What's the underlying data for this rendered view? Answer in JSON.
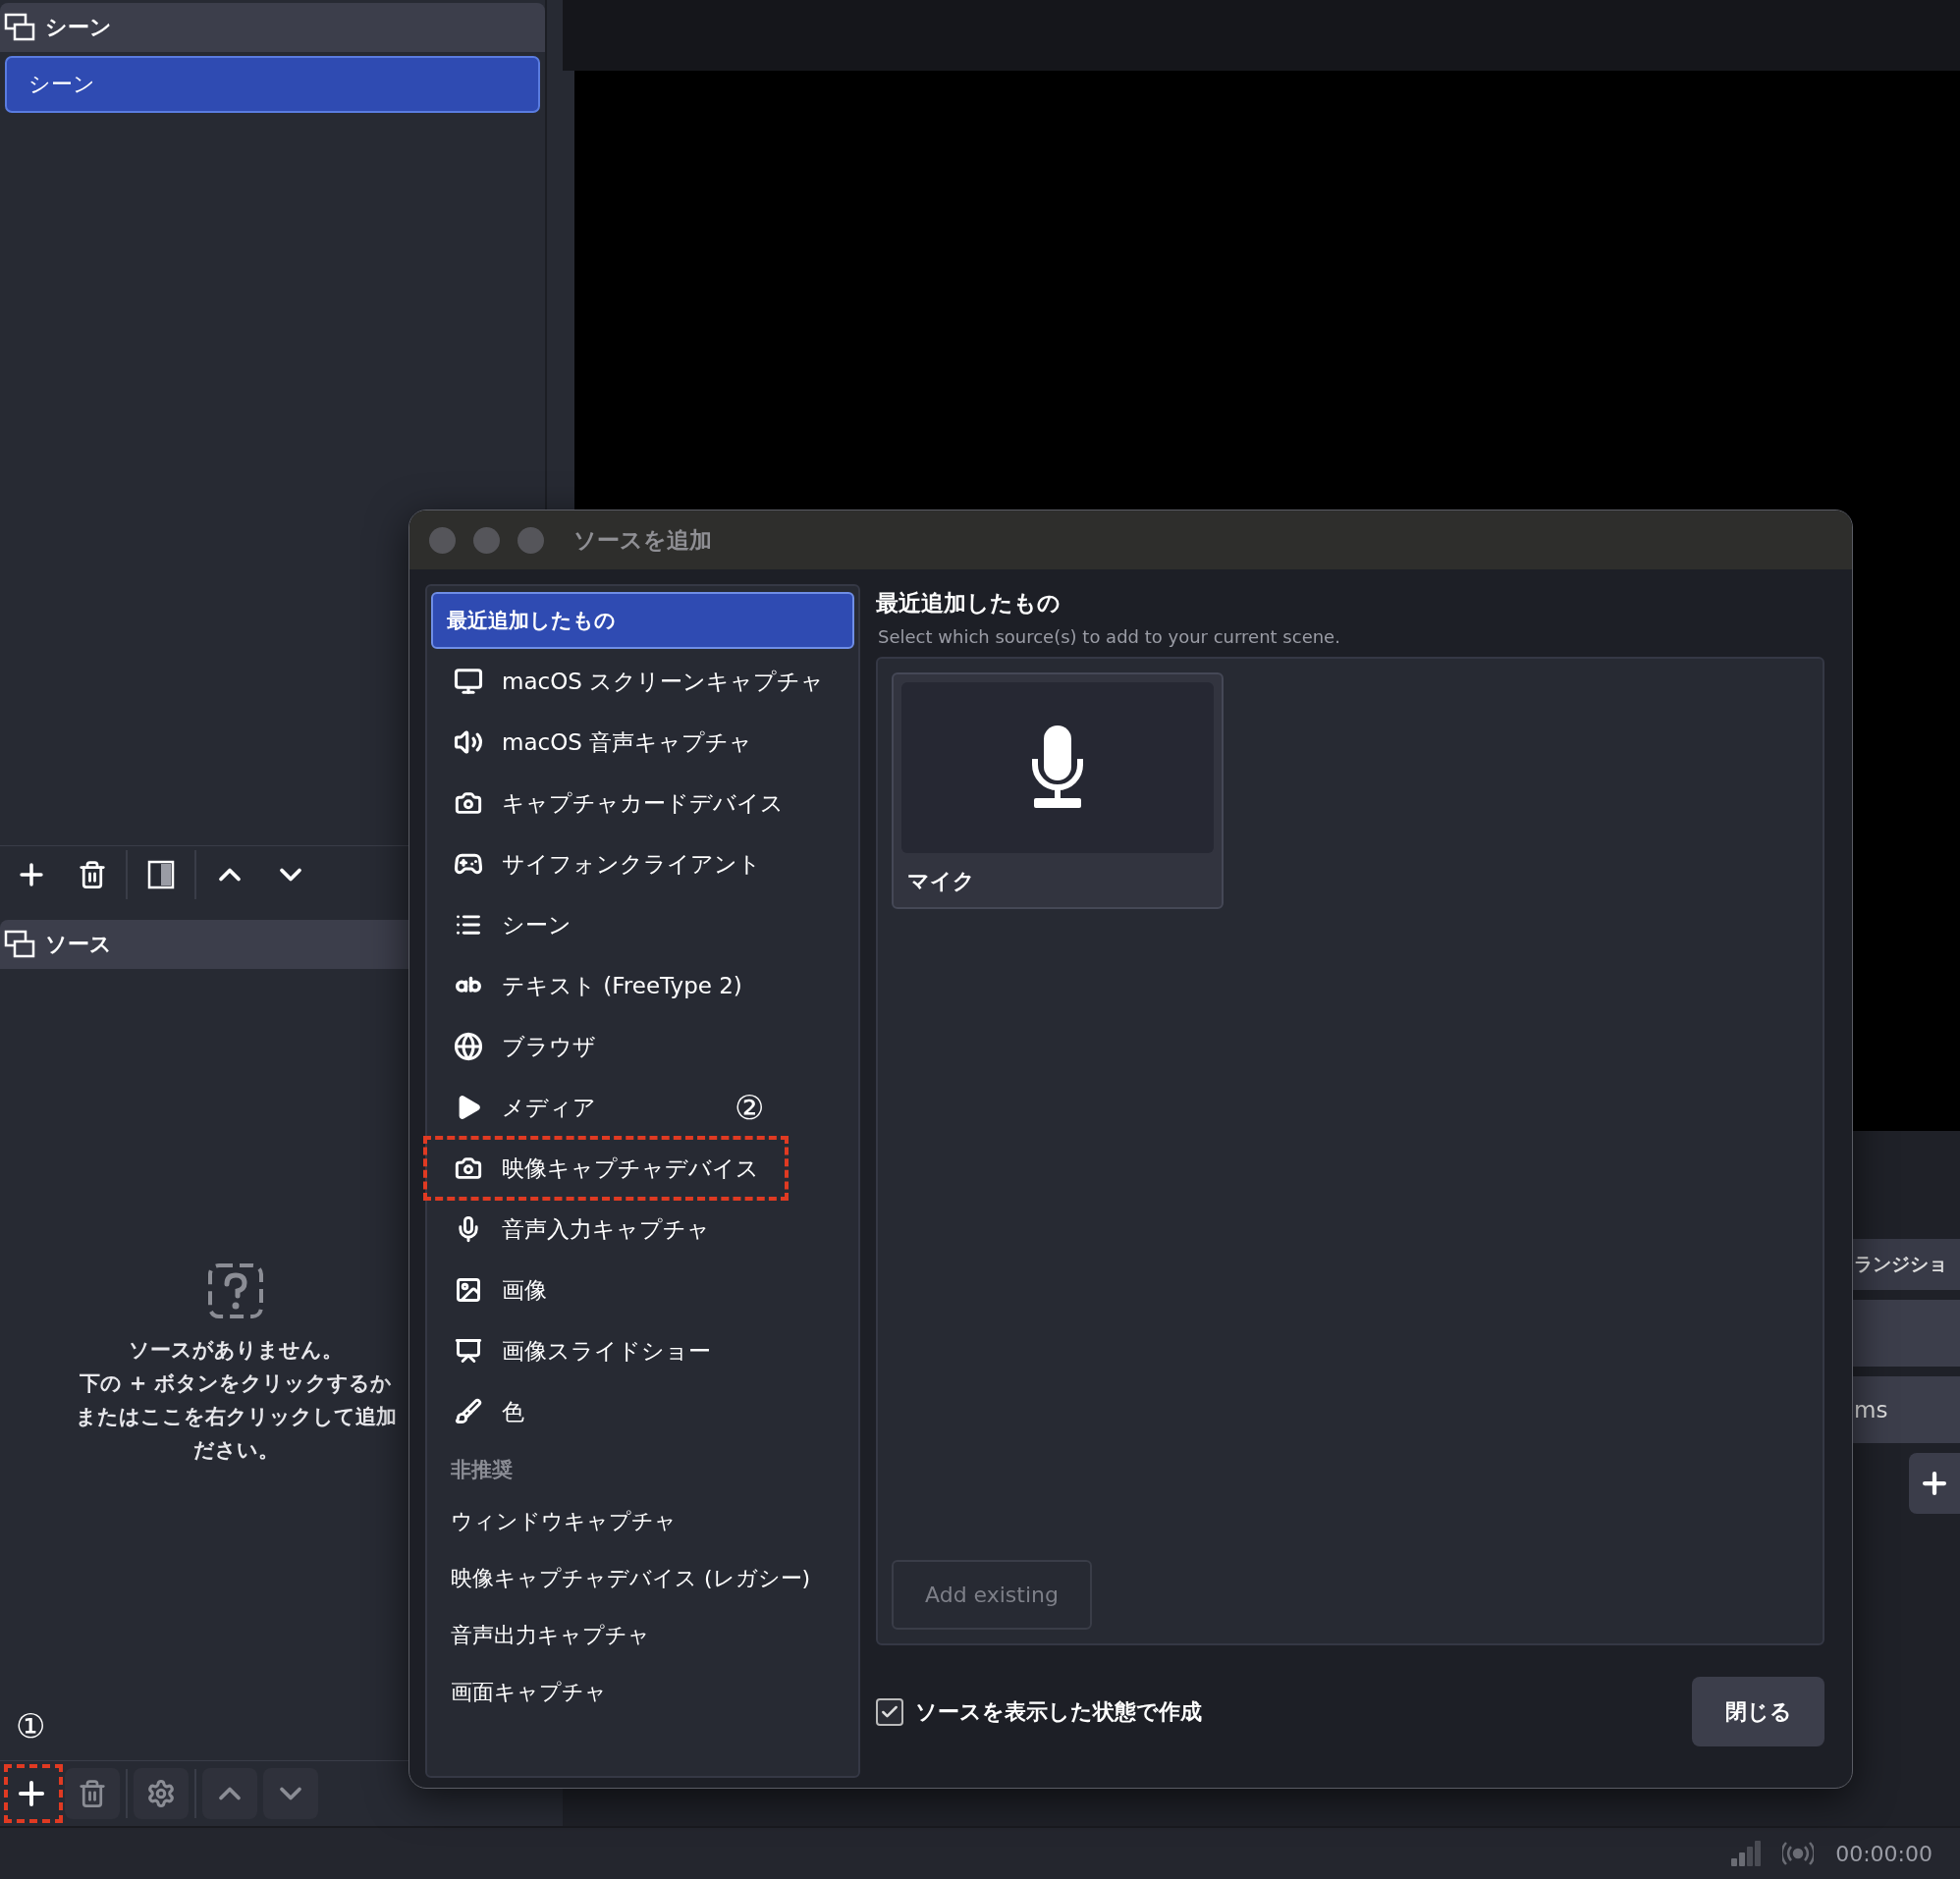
{
  "scenes_panel": {
    "title": "シーン",
    "items": [
      {
        "label": "シーン",
        "selected": true
      }
    ]
  },
  "sources_panel": {
    "title": "ソース",
    "empty_lines": [
      "ソースがありません。",
      "下の + ボタンをクリックするか",
      "またはここを右クリックして追加",
      "ださい。"
    ],
    "toolbar": {
      "add_highlighted": true,
      "add_step_mark": "①"
    }
  },
  "transitions_dock": {
    "title": "ランジショ",
    "duration_unit": "ms"
  },
  "status_bar": {
    "time": "00:00:00"
  },
  "dialog": {
    "title": "ソースを追加",
    "types": [
      {
        "kind": "recent",
        "label": "最近追加したもの",
        "selected": true,
        "highlighted": false
      },
      {
        "kind": "source",
        "label": "macOS スクリーンキャプチャ",
        "selected": false,
        "highlighted": false
      },
      {
        "kind": "source",
        "label": "macOS 音声キャプチャ",
        "selected": false,
        "highlighted": false
      },
      {
        "kind": "source",
        "label": "キャプチャカードデバイス",
        "selected": false,
        "highlighted": false
      },
      {
        "kind": "source",
        "label": "サイフォンクライアント",
        "selected": false,
        "highlighted": false
      },
      {
        "kind": "source",
        "label": "シーン",
        "selected": false,
        "highlighted": false
      },
      {
        "kind": "source",
        "label": "テキスト (FreeType 2)",
        "selected": false,
        "highlighted": false
      },
      {
        "kind": "source",
        "label": "ブラウザ",
        "selected": false,
        "highlighted": false
      },
      {
        "kind": "source",
        "label": "メディア",
        "selected": false,
        "highlighted": false
      },
      {
        "kind": "source",
        "label": "映像キャプチャデバイス",
        "selected": false,
        "highlighted": true,
        "step_mark": "②"
      },
      {
        "kind": "source",
        "label": "音声入力キャプチャ",
        "selected": false,
        "highlighted": false
      },
      {
        "kind": "source",
        "label": "画像",
        "selected": false,
        "highlighted": false
      },
      {
        "kind": "source",
        "label": "画像スライドショー",
        "selected": false,
        "highlighted": false
      },
      {
        "kind": "source",
        "label": "色",
        "selected": false,
        "highlighted": false
      }
    ],
    "deprecated": {
      "title": "非推奨",
      "items": [
        {
          "label": "ウィンドウキャプチャ",
          "selected": false
        },
        {
          "label": "映像キャプチャデバイス (レガシー)",
          "selected": false
        },
        {
          "label": "音声出力キャプチャ",
          "selected": false
        },
        {
          "label": "画面キャプチャ",
          "selected": false
        }
      ]
    },
    "heading": "最近追加したもの",
    "subtitle": "Select which source(s) to add to your current scene.",
    "recent": [
      {
        "label": "マイク"
      }
    ],
    "add_existing": {
      "label": "Add existing",
      "disabled": true
    },
    "visible_checkbox": {
      "label": "ソースを表示した状態で作成",
      "checked": true
    },
    "close_button": "閉じる"
  }
}
